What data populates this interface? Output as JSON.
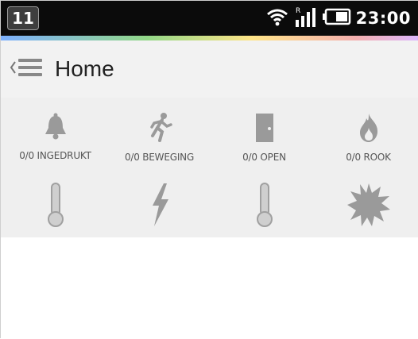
{
  "status_bar": {
    "badge": "11",
    "time": "23:00",
    "icons": [
      "wifi-icon",
      "signal-icon",
      "battery-icon"
    ]
  },
  "action_bar": {
    "title": "Home",
    "icons": [
      "back-chevron-icon",
      "menu-icon"
    ]
  },
  "tiles_row1": [
    {
      "icon": "bell-icon",
      "label": "0/0 INGEDRUKT"
    },
    {
      "icon": "running-person-icon",
      "label": "0/0 BEWEGING"
    },
    {
      "icon": "door-icon",
      "label": "0/0 OPEN"
    },
    {
      "icon": "flame-icon",
      "label": "0/0 ROOK"
    }
  ],
  "tiles_row2": [
    {
      "icon": "thermometer-icon"
    },
    {
      "icon": "lightning-icon"
    },
    {
      "icon": "thermometer-icon"
    },
    {
      "icon": "sun-icon"
    }
  ],
  "colors": {
    "status_bar_bg": "#0b0b0b",
    "action_bar_bg": "#f2f2f2",
    "icon_gray": "#9a9a9a"
  }
}
